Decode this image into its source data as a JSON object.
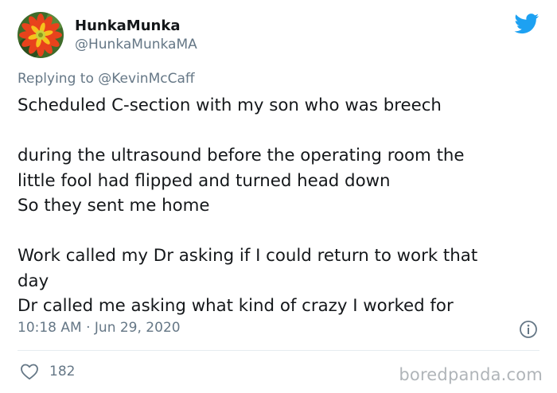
{
  "author": {
    "name": "HunkaMunka",
    "handle": "@HunkaMunkaMA"
  },
  "reply": {
    "prefix": "Replying to",
    "handle": "@KevinMcCaff"
  },
  "tweet": {
    "lines": [
      "Scheduled C-section with my son who was breech",
      "",
      "during the ultrasound before the operating room the",
      "little fool had flipped and turned head down",
      "So they sent me home",
      "",
      "Work called my Dr asking if I could return to work that",
      "day",
      "Dr called me asking what kind of crazy I worked for"
    ]
  },
  "timestamp": "10:18 AM · Jun 29, 2020",
  "likes": {
    "count": "182"
  },
  "watermark": "boredpanda.com",
  "colors": {
    "brand": "#1da1f2",
    "text": "#14171a",
    "secondary": "#657786",
    "divider": "#e6ecf0"
  },
  "icons": {
    "brand": "twitter-bird-icon",
    "info": "info-icon",
    "like": "heart-icon"
  }
}
